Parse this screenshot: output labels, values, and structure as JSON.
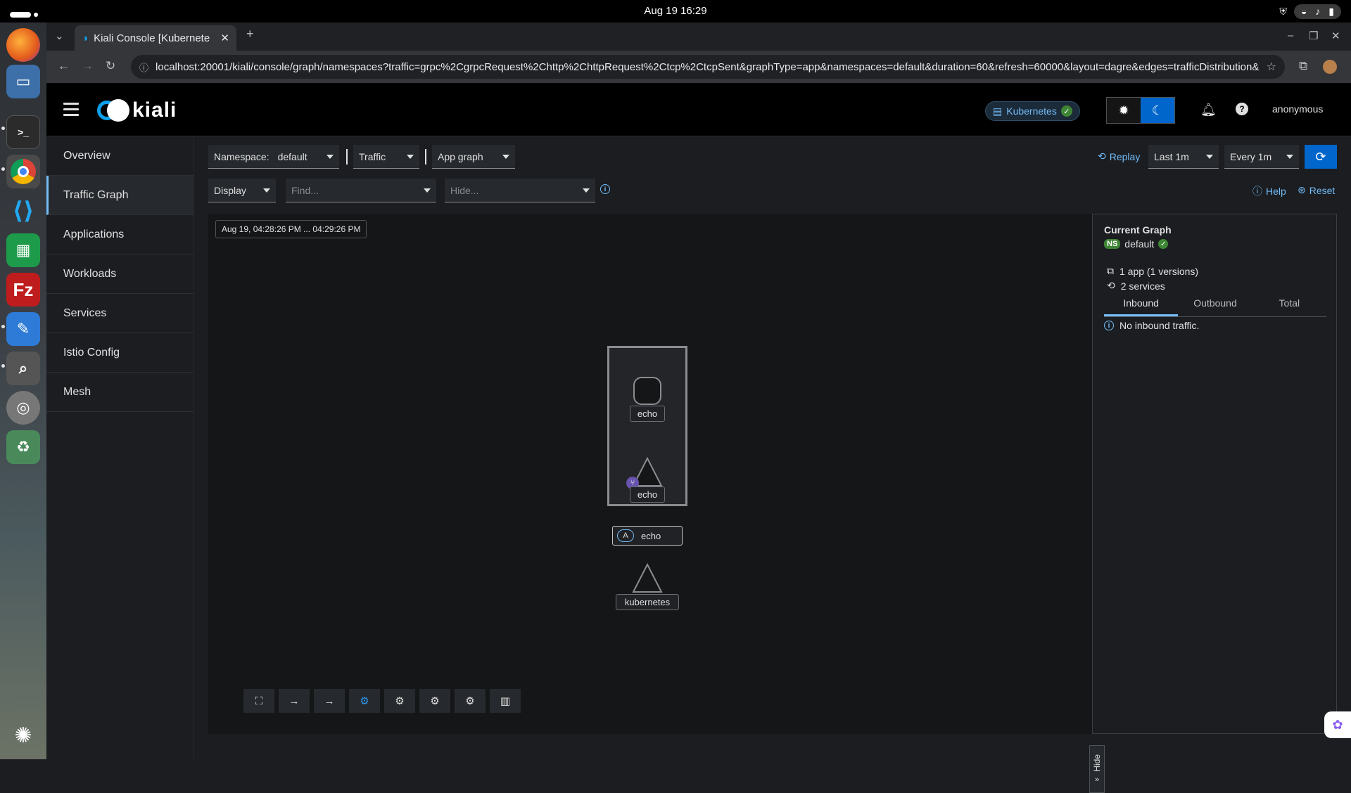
{
  "system": {
    "clock": "Aug 19  16:29"
  },
  "dock": {
    "apps": [
      "Firefox",
      "Files",
      "Terminal",
      "Chrome",
      "VS Code",
      "Spreadsheet",
      "FileZilla",
      "Text Editor",
      "Search",
      "Disk",
      "Trash",
      "Ubuntu"
    ]
  },
  "browser": {
    "tab_title": "Kiali Console [Kubernete",
    "url": "localhost:20001/kiali/console/graph/namespaces?traffic=grpc%2CgrpcRequest%2Chttp%2ChttpRequest%2Ctcp%2CtcpSent&graphType=app&namespaces=default&duration=60&refresh=60000&layout=dagre&edges=trafficDistribution&i..."
  },
  "header": {
    "logo_text": "kiali",
    "cluster_label": "Kubernetes",
    "user": "anonymous"
  },
  "sidebar": {
    "items": [
      {
        "label": "Overview"
      },
      {
        "label": "Traffic Graph",
        "active": true
      },
      {
        "label": "Applications"
      },
      {
        "label": "Workloads"
      },
      {
        "label": "Services"
      },
      {
        "label": "Istio Config"
      },
      {
        "label": "Mesh"
      }
    ]
  },
  "toolbar": {
    "namespace_label": "Namespace:",
    "namespace_value": "default",
    "traffic_label": "Traffic",
    "graph_type": "App graph",
    "replay_label": "Replay",
    "duration": "Last 1m",
    "refresh_interval": "Every 1m",
    "display_label": "Display",
    "find_placeholder": "Find...",
    "hide_placeholder": "Hide...",
    "help_label": "Help",
    "reset_label": "Reset"
  },
  "graph": {
    "time_range": "Aug 19, 04:28:26 PM ... 04:29:26 PM",
    "nodes": {
      "workload_label": "echo",
      "service_label": "echo",
      "app_badge": "A",
      "app_label": "echo",
      "kubernetes_label": "kubernetes"
    },
    "hide_label": "Hide"
  },
  "panel": {
    "title": "Current Graph",
    "ns_badge": "NS",
    "namespace": "default",
    "apps_stat": "1 app (1 versions)",
    "services_stat": "2 services",
    "tabs": [
      "Inbound",
      "Outbound",
      "Total"
    ],
    "active_tab": "Inbound",
    "message": "No inbound traffic."
  },
  "colors": {
    "accent": "#0066cc",
    "link": "#73bcf7",
    "ok": "#3e8635"
  }
}
